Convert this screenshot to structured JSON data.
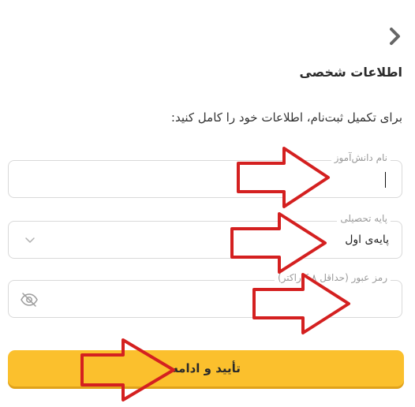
{
  "header": {
    "back_icon": "chevron-right-icon"
  },
  "page": {
    "title": "اطلاعات شخصی",
    "subtitle": "برای تکمیل ثبت‌نام، اطلاعات خود را کامل کنید:"
  },
  "form": {
    "student_name": {
      "label": "نام دانش‌آموز",
      "value": ""
    },
    "grade": {
      "label": "پایه تحصیلی",
      "value": "پایه‌ی اول",
      "icon": "chevron-down-icon"
    },
    "password": {
      "label": "رمز عبور (حداقل ۸ کاراکتر)",
      "value": "",
      "icon": "eye-off-icon"
    },
    "submit_label": "تأیید و ادامه"
  },
  "colors": {
    "accent": "#fbc02d",
    "annotation_arrow": "#d42020"
  }
}
